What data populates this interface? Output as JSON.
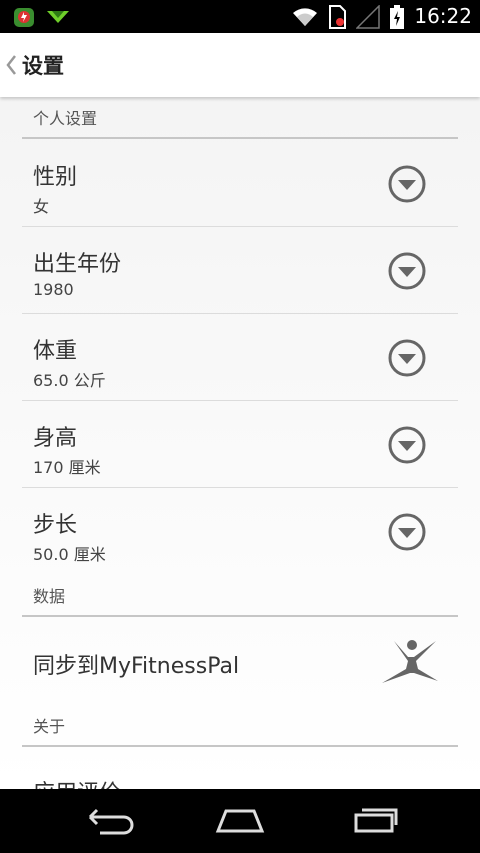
{
  "status_bar": {
    "time": "16:22",
    "left_icons": [
      "notification-app-icon",
      "download-arrow-icon"
    ],
    "right_icons": [
      "wifi-icon",
      "sim-card-icon",
      "cell-signal-icon",
      "battery-charging-icon"
    ]
  },
  "action_bar": {
    "back_icon": "chevron-left-icon",
    "title": "设置"
  },
  "sections": {
    "personal": {
      "header": "个人设置"
    },
    "data": {
      "header": "数据"
    },
    "about": {
      "header": "关于"
    }
  },
  "settings": [
    {
      "title": "性别",
      "value": "女",
      "icon": "dropdown-circle-icon"
    },
    {
      "title": "出生年份",
      "value": "1980",
      "icon": "dropdown-circle-icon"
    },
    {
      "title": "体重",
      "value": "65.0 公斤",
      "icon": "dropdown-circle-icon"
    },
    {
      "title": "身高",
      "value": "170 厘米",
      "icon": "dropdown-circle-icon"
    },
    {
      "title": "步长",
      "value": "50.0 厘米",
      "icon": "dropdown-circle-icon"
    }
  ],
  "sync": {
    "title": "同步到MyFitnessPal",
    "icon": "myfitnesspal-icon"
  },
  "about": {
    "partial_item": "应用评价"
  },
  "nav_bar": {
    "icons": [
      "back-icon",
      "home-icon",
      "recent-apps-icon"
    ]
  },
  "colors": {
    "status_bar": "#000000",
    "action_bar": "#ffffff",
    "content_bg": "#f4f4f4",
    "divider": "#c6c6c6",
    "icon_gray": "#666666"
  }
}
